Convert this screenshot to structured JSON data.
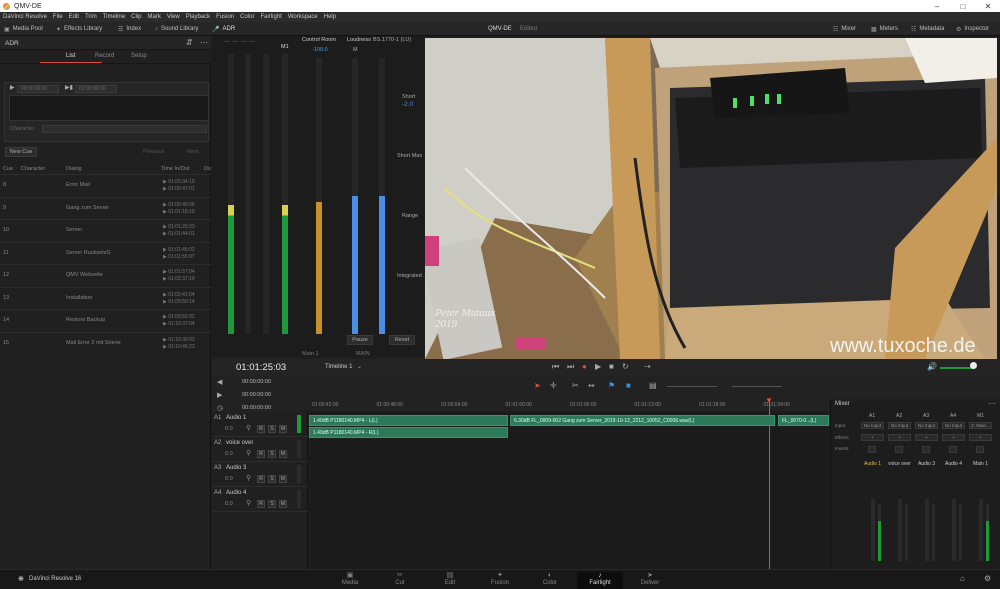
{
  "window": {
    "title": "QMV-DE"
  },
  "menu": [
    "DaVinci Resolve",
    "File",
    "Edit",
    "Trim",
    "Timeline",
    "Clip",
    "Mark",
    "View",
    "Playback",
    "Fusion",
    "Color",
    "Fairlight",
    "Workspace",
    "Help"
  ],
  "toolbar": {
    "media_pool": "Media Pool",
    "effects_library": "Effects Library",
    "index": "Index",
    "sound_library": "Sound Library",
    "adr": "ADR",
    "project": "QMV-DE",
    "status": "Edited",
    "mixer": "Mixer",
    "meters": "Meters",
    "metadata": "Metadata",
    "inspector": "Inspector"
  },
  "adr": {
    "title": "ADR",
    "tabs": [
      "List",
      "Record",
      "Setup"
    ],
    "record_in": "00:00:00:00",
    "record_out": "00:00:00:00",
    "character_label": "Character",
    "new_cue": "New Cue",
    "previous": "Previous",
    "next": "Next",
    "columns": [
      "Cue",
      "Character",
      "Dialog",
      "Time In/Out",
      "Du"
    ],
    "rows": [
      {
        "cue": "8",
        "dialog": "Error Mail",
        "tin": "01:00:34:19",
        "tout": "01:00:47:01"
      },
      {
        "cue": "9",
        "dialog": "Gang zum Server",
        "tin": "01:00:49:06",
        "tout": "01:01:18:19"
      },
      {
        "cue": "10",
        "dialog": "Server",
        "tin": "01:01:20:23",
        "tout": "01:01:44:01"
      },
      {
        "cue": "11",
        "dialog": "Server RucksetzG",
        "tin": "01:01:45:02",
        "tout": "01:01:55:07"
      },
      {
        "cue": "12",
        "dialog": "QMV Webseite",
        "tin": "01:01:57:04",
        "tout": "01:02:37:19"
      },
      {
        "cue": "13",
        "dialog": "Installation",
        "tin": "01:02:41:04",
        "tout": "01:09:50:14"
      },
      {
        "cue": "14",
        "dialog": "Restore Backup",
        "tin": "01:09:52:02",
        "tout": "01:10:37:04"
      },
      {
        "cue": "15",
        "dialog": "Mail Error 2 mit Sirene",
        "tin": "01:10:39:03",
        "tout": "01:10:46:23"
      }
    ]
  },
  "meters": {
    "m1": "M1",
    "control_room": "Control Room",
    "control_value": "-100.0",
    "loudness": "Loudness",
    "standard": "BS.1770-1 (LU)",
    "m": "M",
    "short": "Short",
    "short_value": "-2.0",
    "short_max": "Short Max",
    "range": "Range",
    "integrated": "Integrated",
    "pause": "Pause",
    "reset": "Reset",
    "main": "Main 1",
    "main2": "MAIN",
    "level_m1": 0.46,
    "level_cr": 0.48,
    "level_loud1": 0.5,
    "level_loud2": 0.5
  },
  "viewer": {
    "watermark": "www.tuxoche.de",
    "signature": "Peter Mutaux 2019"
  },
  "timeline": {
    "timecode": "01:01:25:03",
    "name": "Timeline 1",
    "ruler": [
      "01:00:42:00",
      "01:00:48:00",
      "01:00:54:00",
      "01:01:00:00",
      "01:01:06:00",
      "01:01:12:00",
      "01:01:18:00",
      "01:01:24:00"
    ],
    "sub_tc": [
      "00:00:00:00",
      "00:00:00:00",
      "00:00:00:00"
    ],
    "tracks": [
      {
        "id": "A1",
        "name": "Audio 1",
        "vol": "0.0"
      },
      {
        "id": "A2",
        "name": "voice over",
        "vol": "0.0"
      },
      {
        "id": "A3",
        "name": "Audio 3",
        "vol": "0.0"
      },
      {
        "id": "A4",
        "name": "Audio 4",
        "vol": "0.0"
      }
    ],
    "rsm": [
      "R",
      "S",
      "M"
    ],
    "clips": [
      "1.40dB  P1180140.MP4 - L(L)",
      "1.40dB  P1180140.MP4 - R(L)",
      "6.30dB  FL_0009-002 Gang zum Server_2019-10-12_2212_10052_C0006.wav(L)",
      "FL_0070-0...(L)"
    ]
  },
  "mixer": {
    "title": "Mixer",
    "channels": [
      "A1",
      "A2",
      "A3",
      "A4",
      "M1"
    ],
    "input": "Input",
    "effects": "Effects",
    "inserts": "Inserts",
    "no_input": "No Input",
    "main": "2: Main...",
    "names": [
      "Audio 1",
      "voice over",
      "Audio 3",
      "Audio 4",
      "Main 1"
    ]
  },
  "pages": [
    "Media",
    "Cut",
    "Edit",
    "Fusion",
    "Color",
    "Fairlight",
    "Deliver"
  ],
  "app_name": "DaVinci Resolve 16"
}
